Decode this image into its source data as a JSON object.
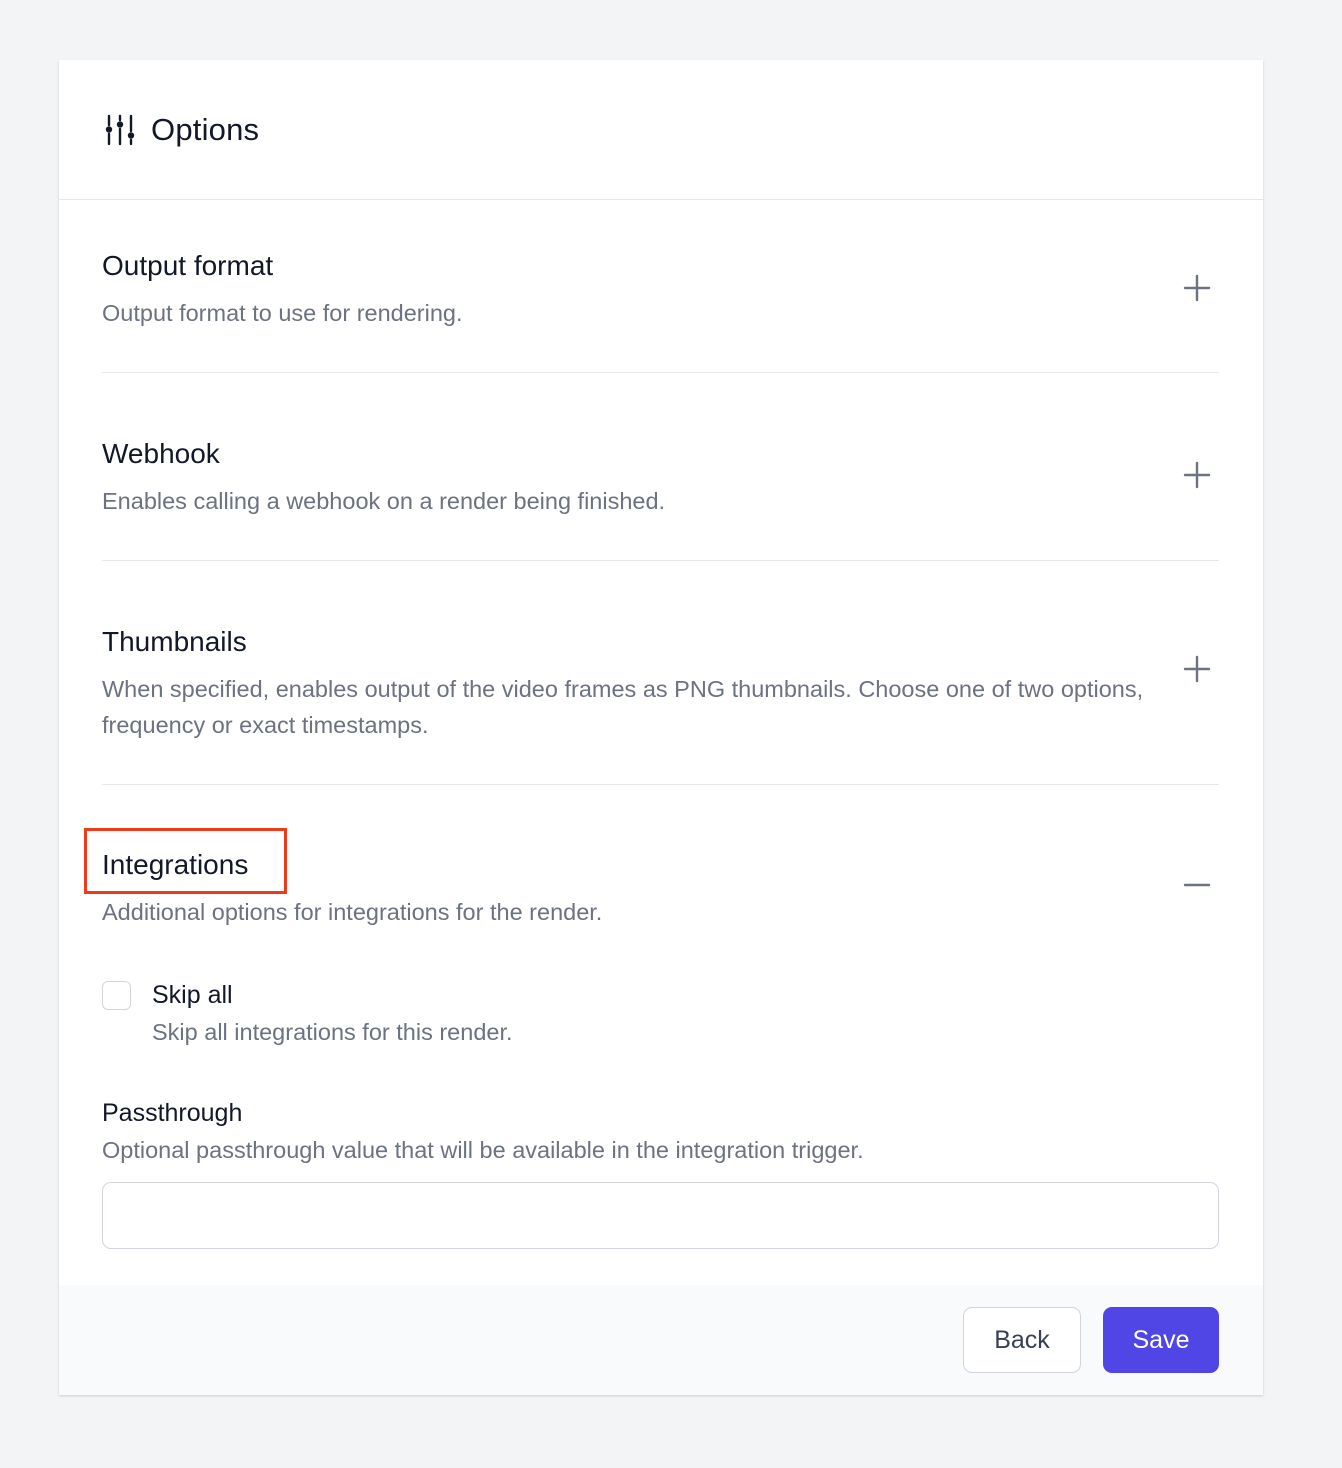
{
  "header": {
    "title": "Options",
    "icon": "sliders-icon"
  },
  "sections": [
    {
      "title": "Output format",
      "description": "Output format to use for rendering.",
      "toggle": "plus-icon",
      "expanded": false
    },
    {
      "title": "Webhook",
      "description": "Enables calling a webhook on a render being finished.",
      "toggle": "plus-icon",
      "expanded": false
    },
    {
      "title": "Thumbnails",
      "description": "When specified, enables output of the video frames as PNG thumbnails. Choose one of two options, frequency or exact timestamps.",
      "toggle": "plus-icon",
      "expanded": false
    },
    {
      "title": "Integrations",
      "description": "Additional options for integrations for the render.",
      "toggle": "minus-icon",
      "expanded": true
    }
  ],
  "integrations": {
    "skip_all": {
      "label": "Skip all",
      "description": "Skip all integrations for this render.",
      "checked": false
    },
    "passthrough": {
      "label": "Passthrough",
      "description": "Optional passthrough value that will be available in the integration trigger.",
      "value": "",
      "placeholder": ""
    }
  },
  "footer": {
    "back_label": "Back",
    "save_label": "Save"
  },
  "colors": {
    "accent": "#4f46e5",
    "highlight": "#ef3a1c",
    "muted_text": "#6b7280",
    "background": "#f3f4f6"
  }
}
